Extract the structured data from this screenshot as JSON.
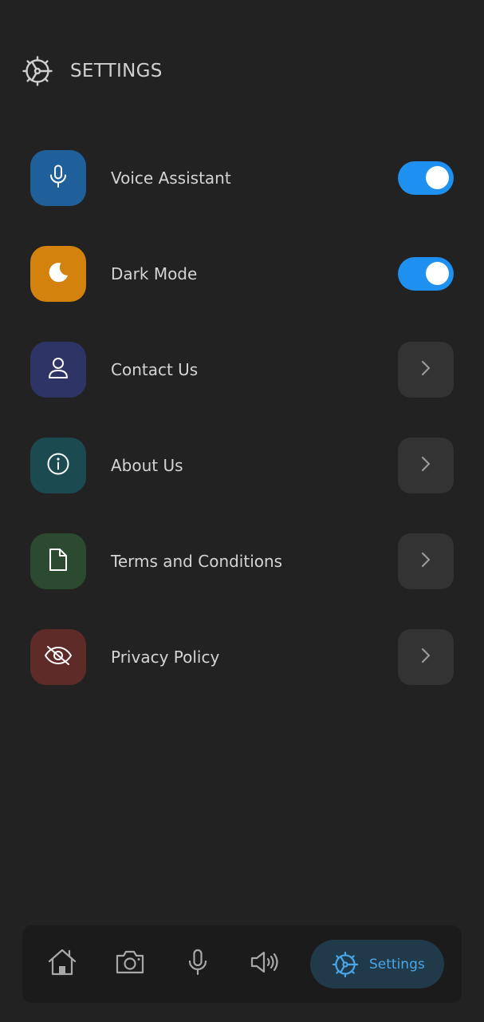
{
  "header": {
    "title": "SETTINGS",
    "icon": "gear-icon"
  },
  "settings": [
    {
      "label": "Voice Assistant",
      "icon": "microphone-icon",
      "tile_color": "#1f5f9a",
      "control": "toggle",
      "enabled": true
    },
    {
      "label": "Dark Mode",
      "icon": "moon-icon",
      "tile_color": "#d3820e",
      "control": "toggle",
      "enabled": true
    },
    {
      "label": "Contact Us",
      "icon": "user-icon",
      "tile_color": "#2e3466",
      "control": "chevron"
    },
    {
      "label": "About Us",
      "icon": "info-icon",
      "tile_color": "#1b4a50",
      "control": "chevron"
    },
    {
      "label": "Terms and Conditions",
      "icon": "document-icon",
      "tile_color": "#2b4a2f",
      "control": "chevron"
    },
    {
      "label": "Privacy Policy",
      "icon": "eye-off-icon",
      "tile_color": "#5e2b28",
      "control": "chevron"
    }
  ],
  "nav": {
    "items": [
      {
        "icon": "home-icon"
      },
      {
        "icon": "camera-icon"
      },
      {
        "icon": "microphone-icon"
      },
      {
        "icon": "speaker-icon"
      }
    ],
    "active": {
      "label": "Settings",
      "icon": "gear-icon"
    }
  },
  "colors": {
    "background": "#222222",
    "toggle_on": "#1e90f0",
    "chevron_bg": "#333333",
    "nav_bg": "#1b1b1b",
    "nav_active_bg": "#213a4a",
    "accent": "#4aa6e8"
  }
}
